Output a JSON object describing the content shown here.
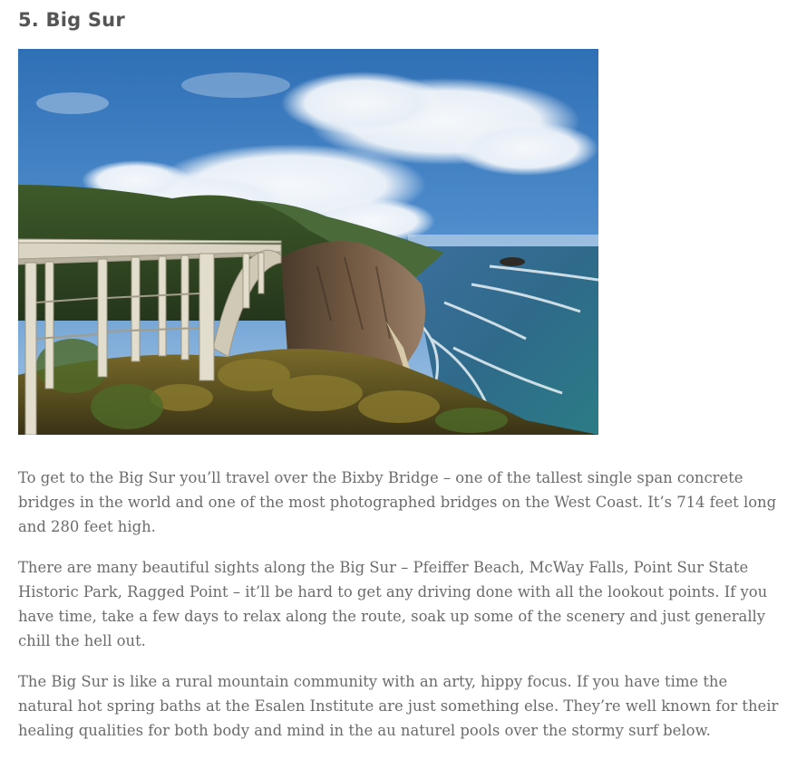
{
  "section": {
    "title": "5. Big Sur"
  },
  "image": {
    "subject": "bixby-bridge-coastline-photo"
  },
  "paragraphs": [
    "To get to the Big Sur you’ll travel over the Bixby Bridge – one of the tallest single span concrete bridges in the world and one of the most photographed bridges on the West Coast. It’s 714 feet long and 280 feet high.",
    "There are many beautiful sights along the Big Sur – Pfeiffer Beach, McWay Falls, Point Sur State Historic Park, Ragged Point – it’ll be hard to get any driving done with all the lookout points. If you have time, take a few days to relax along the route, soak up some of the scenery and just generally chill the hell out.",
    "The Big Sur is like a rural mountain community with an arty, hippy focus. If you have time the natural hot spring baths at the Esalen Institute are just something else. They’re well known for their healing qualities for both body and mind in the au naturel pools over the stormy surf below."
  ],
  "colors": {
    "heading": "#555555",
    "body_text": "#6b6b6b",
    "background": "#ffffff"
  }
}
